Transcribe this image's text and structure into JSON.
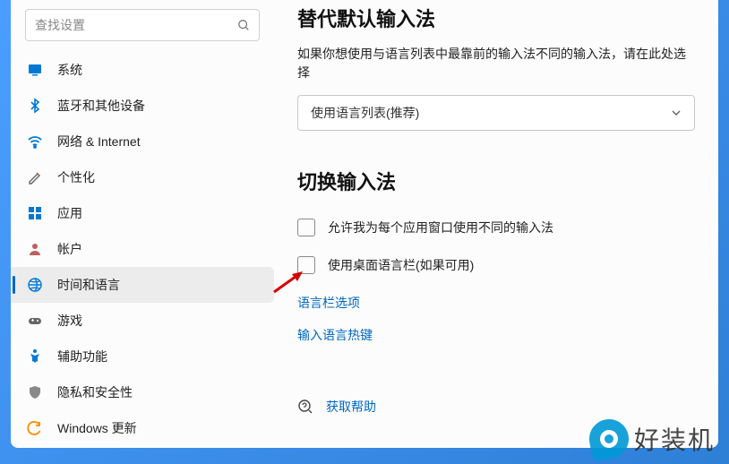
{
  "search": {
    "placeholder": "查找设置"
  },
  "sidebar": {
    "items": [
      {
        "label": "系统",
        "icon": "system"
      },
      {
        "label": "蓝牙和其他设备",
        "icon": "bluetooth"
      },
      {
        "label": "网络 & Internet",
        "icon": "network"
      },
      {
        "label": "个性化",
        "icon": "personalize"
      },
      {
        "label": "应用",
        "icon": "apps"
      },
      {
        "label": "帐户",
        "icon": "accounts"
      },
      {
        "label": "时间和语言",
        "icon": "time-language",
        "active": true
      },
      {
        "label": "游戏",
        "icon": "gaming"
      },
      {
        "label": "辅助功能",
        "icon": "accessibility"
      },
      {
        "label": "隐私和安全性",
        "icon": "privacy"
      },
      {
        "label": "Windows 更新",
        "icon": "update"
      }
    ]
  },
  "main": {
    "section1_title": "替代默认输入法",
    "section1_desc": "如果你想使用与语言列表中最靠前的输入法不同的输入法，请在此处选择",
    "dropdown_value": "使用语言列表(推荐)",
    "section2_title": "切换输入法",
    "checkbox1_label": "允许我为每个应用窗口使用不同的输入法",
    "checkbox2_label": "使用桌面语言栏(如果可用)",
    "link1": "语言栏选项",
    "link2": "输入语言热键",
    "help_label": "获取帮助"
  },
  "watermark": "好装机"
}
